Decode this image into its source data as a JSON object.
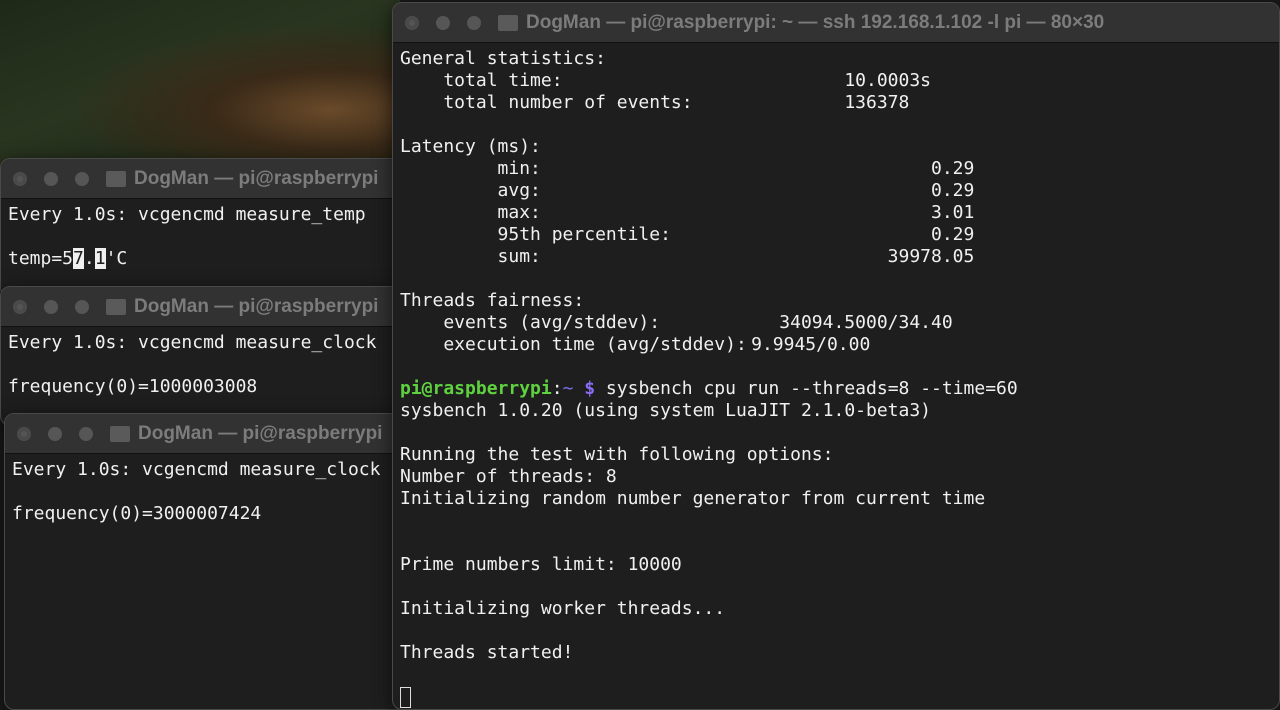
{
  "windows": {
    "temp": {
      "title": "DogMan — pi@raspberrypi",
      "header": "Every 1.0s: vcgencmd measure_temp",
      "out_pre": "temp=5",
      "out_hl1": "7",
      "out_mid": ".",
      "out_hl2": "1",
      "out_post": "'C"
    },
    "clock1": {
      "title": "DogMan — pi@raspberrypi",
      "header": "Every 1.0s: vcgencmd measure_clock",
      "output": "frequency(0)=1000003008"
    },
    "clock2": {
      "title": "DogMan — pi@raspberrypi",
      "header": "Every 1.0s: vcgencmd measure_clock",
      "output": "frequency(0)=3000007424"
    },
    "main": {
      "title": "DogMan — pi@raspberrypi: ~ — ssh 192.168.1.102 -l pi — 80×30",
      "general": {
        "heading": "General statistics:",
        "total_time_label": "    total time:",
        "total_time": "10.0003s",
        "events_label": "    total number of events:",
        "events": "136378"
      },
      "latency": {
        "heading": "Latency (ms):",
        "min_label": "         min:",
        "min": "0.29",
        "avg_label": "         avg:",
        "avg": "0.29",
        "max_label": "         max:",
        "max": "3.01",
        "p95_label": "         95th percentile:",
        "p95": "0.29",
        "sum_label": "         sum:",
        "sum": "39978.05"
      },
      "fairness": {
        "heading": "Threads fairness:",
        "events_label": "    events (avg/stddev):",
        "events": "34094.5000/34.40",
        "exec_label": "    execution time (avg/stddev):",
        "exec": "9.9945/0.00"
      },
      "prompt": {
        "user_host": "pi@raspberrypi",
        "colon": ":",
        "dir": "~",
        "symbol": " $",
        "command": " sysbench cpu run --threads=8 --time=60"
      },
      "output": [
        "sysbench 1.0.20 (using system LuaJIT 2.1.0-beta3)",
        "Running the test with following options:",
        "Number of threads: 8",
        "Initializing random number generator from current time",
        "Prime numbers limit: 10000",
        "Initializing worker threads...",
        "Threads started!"
      ]
    }
  },
  "colors": {
    "prompt_user": "#5fd33f",
    "prompt_symbol": "#8a6cf5",
    "terminal_bg": "#1e1e1e"
  }
}
